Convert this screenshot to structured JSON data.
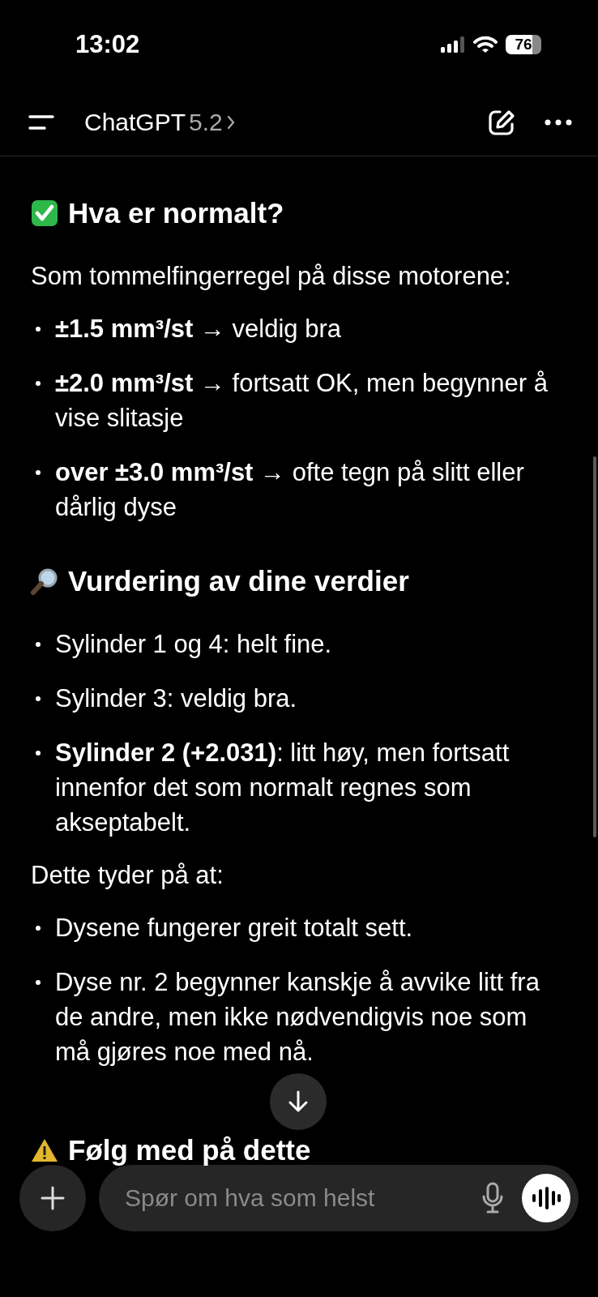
{
  "status_bar": {
    "time": "13:02",
    "battery": "76"
  },
  "header": {
    "title": "ChatGPT",
    "version": "5.2"
  },
  "message": [
    {
      "kind": "heading",
      "text": "Hva er normalt?"
    },
    {
      "kind": "paragraph",
      "text": "Som tommelfingerregel på disse motorene:"
    },
    {
      "kind": "bullets",
      "items": [
        "**±1.5 mm³/st** → veldig bra",
        "**±2.0 mm³/st** → fortsatt OK, men begynner å vise slitasje",
        "**over ±3.0 mm³/st** → ofte tegn på slitt eller dårlig dyse"
      ]
    },
    {
      "kind": "heading",
      "text": "Vurdering av dine verdier"
    },
    {
      "kind": "bullets",
      "items": [
        "Sylinder 1 og 4: helt fine.",
        "Sylinder 3: veldig bra.",
        "**Sylinder 2 (+2.031)**: litt høy, men fortsatt innenfor det som normalt regnes som akseptabelt."
      ]
    },
    {
      "kind": "paragraph",
      "text": "Dette tyder på at:"
    },
    {
      "kind": "bullets",
      "items": [
        "Dysene fungerer greit totalt sett.",
        "Dyse nr. 2 begynner kanskje å avvike litt fra de andre, men ikke nødvendigvis noe som må gjøres noe med nå."
      ]
    },
    {
      "kind": "heading",
      "text": "Følg med på dette"
    }
  ],
  "composer": {
    "placeholder": "Spør om hva som helst"
  }
}
